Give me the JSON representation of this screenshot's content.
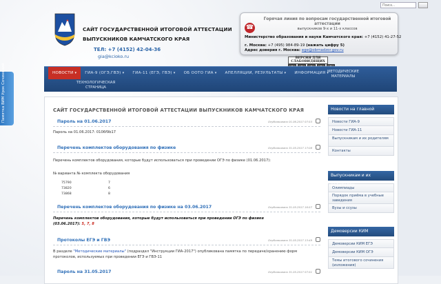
{
  "header": {
    "title": "САЙТ ГОСУДАРСТВЕННОЙ ИТОГОВОЙ АТТЕСТАЦИИ",
    "subtitle": "ВЫПУСКНИКОВ КАМЧАТСКОГО КРАЯ",
    "phone": "ТЕЛ: +7 (4152) 42-04-36",
    "email": "gia@kcioko.ru",
    "search_placeholder": "Поиск..."
  },
  "hotline": {
    "title": "Горячая линия по вопросам государственной итоговой аттестации",
    "sub": "выпускников 9-х и 11-х классов",
    "ministry_label": "Министерство образования и науки Камчатского края:",
    "ministry_phone": "+7 (4152) 41-27-52",
    "moscow_label": "г. Москва:",
    "moscow_phone": "+7 (495) 984-89-19",
    "moscow_note": "(нажать цифру 5)",
    "trust_label": "Адрес доверия г. Москва:",
    "trust_email": "ege@obrnadzor.gov.ru"
  },
  "accessibility": {
    "vision_label": "ВЕРСИЯ ДЛЯ СЛАБОВИДЯЩИХ",
    "font_buttons": [
      "A",
      "A",
      "A",
      "A",
      "A"
    ]
  },
  "side_tab": {
    "label": "Памятка ВИМ Урок Сочинений"
  },
  "nav": {
    "items": [
      {
        "label": "НОВОСТИ",
        "active": true
      },
      {
        "label": "ГИА-9 (ОГЭ,ГВЭ)",
        "active": false
      },
      {
        "label": "ГИА-11 (ЕГЭ, ГВЭ)",
        "active": false
      },
      {
        "label": "ОБ ООТО ГИА",
        "active": false
      },
      {
        "label": "АПЕЛЛЯЦИИ, РЕЗУЛЬТАТЫ",
        "active": false
      },
      {
        "label": "ИНФОРМАЦИЯ",
        "active": false
      }
    ],
    "materials": "МЕТОДИЧЕСКИЕ МАТЕРИАЛЫ",
    "tech": "ТЕХНОЛОГИЧЕСКАЯ СТРАНИЦА"
  },
  "content": {
    "page_title": "САЙТ ГОСУДАРСТВЕННОЙ ИТОГОВОЙ АТТЕСТАЦИИ ВЫПУСКНИКОВ КАМЧАТСКОГО КРАЯ",
    "articles": [
      {
        "title_prefix": "Пароль на",
        "title_date": "01.06.2017",
        "meta": "Опубликовано 01.06.2017 07:53",
        "body": "Пароль на 01.06.2017: 0106f9b17"
      },
      {
        "title_prefix": "Перечень комплектов оборудования по физике",
        "title_date": "",
        "meta": "Опубликовано 31.05.2017 17:08",
        "body": "Перечень комплектов оборудования, которые будут использоваться при проведении ОГЭ по физике (01.06.2017):",
        "table_header": "№ варианта    № комплекта оборудования",
        "table_rows": [
          {
            "variant": "75790",
            "set": "7"
          },
          {
            "variant": "73820",
            "set": "6"
          },
          {
            "variant": "73868",
            "set": "8"
          }
        ]
      },
      {
        "title_prefix": "Перечень комплектов оборудования по физике на",
        "title_date": "03.06.2017",
        "meta": "Опубликовано 31.05.2017 16:57",
        "body": "Перечень комплектов оборудования, которые будут использоваться при проведении ОГЭ по физике",
        "body2": "(03.06.2017):",
        "body2_nums": "5, 7, 8"
      },
      {
        "title_prefix": "Протоколы ЕГЭ и ГВЭ",
        "title_date": "",
        "meta": "Опубликовано 31.05.2017 13:49",
        "body_prefix": "В разделе",
        "body_link": "\"Методические материалы\"",
        "body_suffix": "(подраздел \"Инструкции ГИА-2017\") опубликована памятка по передаче/хранению форм",
        "body2": "протоколов, используемых при проведении ЕГЭ и ГВЭ-11"
      },
      {
        "title_prefix": "Пароль на",
        "title_date": "31.05.2017",
        "meta": "Опубликовано 31.05.2017 07:51",
        "body": ""
      }
    ]
  },
  "sidebar": {
    "sections": [
      {
        "header": "Новости на главной",
        "items": [
          "Новости ГИА-9",
          "Новости ГИА-11",
          "Выпускникам и их родителям",
          "Контакты"
        ]
      },
      {
        "header": "Выпускникам и их родителям",
        "items": [
          "Олимпиады",
          "Порядок приёма в учебные заведения",
          "Вузы и ссузы"
        ]
      },
      {
        "header": "Демоверсии КИМ",
        "items": [
          "Демоверсии КИМ ЕГЭ",
          "Демоверсии КИМ ОГЭ",
          "Темы итогового сочинения (изложения)"
        ]
      }
    ]
  },
  "colors": {
    "nav_bg": "#2a5489",
    "nav_active": "#c72f25",
    "link": "#2f6fb8",
    "sidebar_header": "#2c5a94"
  }
}
